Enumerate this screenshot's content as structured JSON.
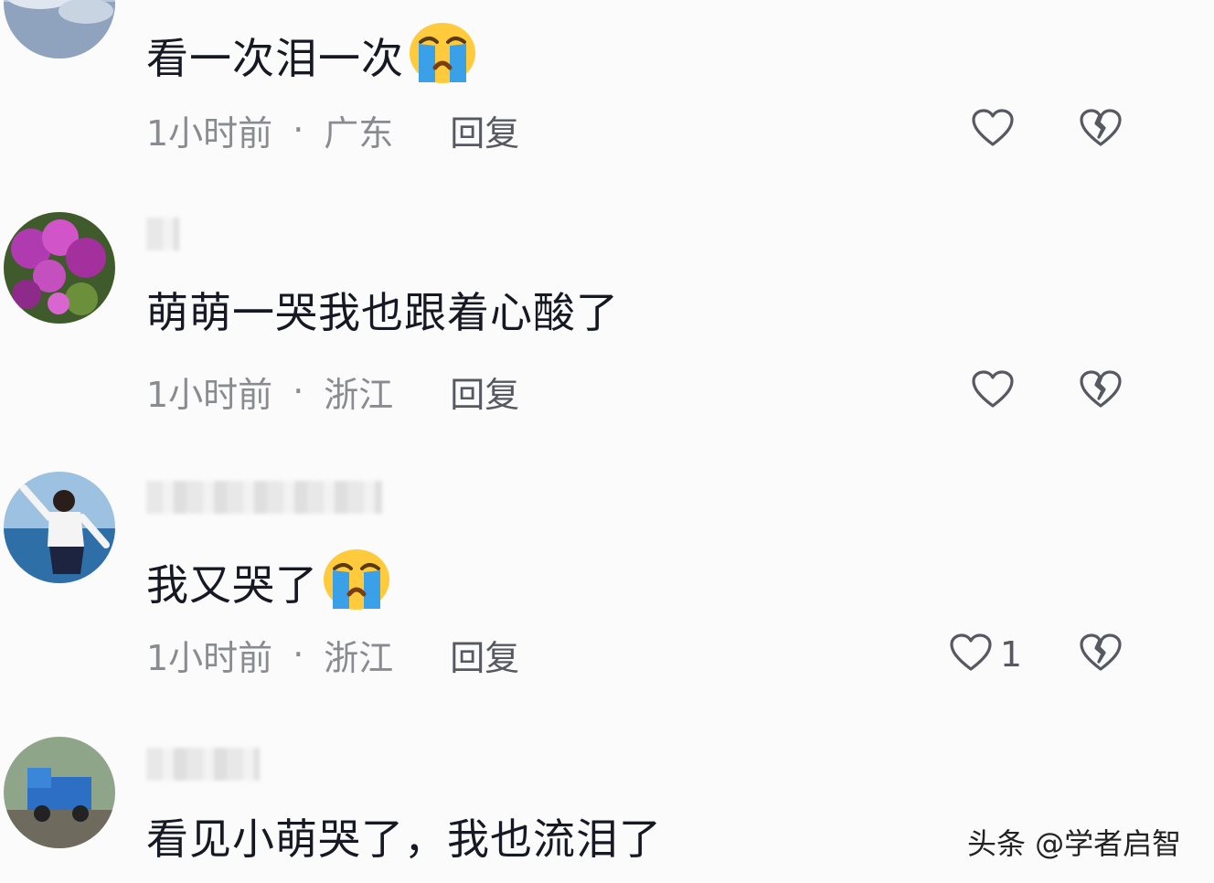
{
  "comments": [
    {
      "text": "看一次泪一次",
      "time": "1小时前",
      "location": "广东",
      "reply_label": "回复",
      "like_count": "",
      "emoji": "loudly-crying-face"
    },
    {
      "text": "萌萌一哭我也跟着心酸了",
      "time": "1小时前",
      "location": "浙江",
      "reply_label": "回复",
      "like_count": ""
    },
    {
      "text": "我又哭了",
      "time": "1小时前",
      "location": "浙江",
      "reply_label": "回复",
      "like_count": "1",
      "emoji": "loudly-crying-face"
    },
    {
      "text": "看见小萌哭了，我也流泪了"
    }
  ],
  "separator": "·",
  "watermark": "头条 @学者启智",
  "colors": {
    "background": "#fbfbfb",
    "text": "#161823",
    "meta": "#8a8b91",
    "icon": "#575861",
    "emoji_face": "#ffcb3c",
    "emoji_tear": "#3aa0e8"
  }
}
